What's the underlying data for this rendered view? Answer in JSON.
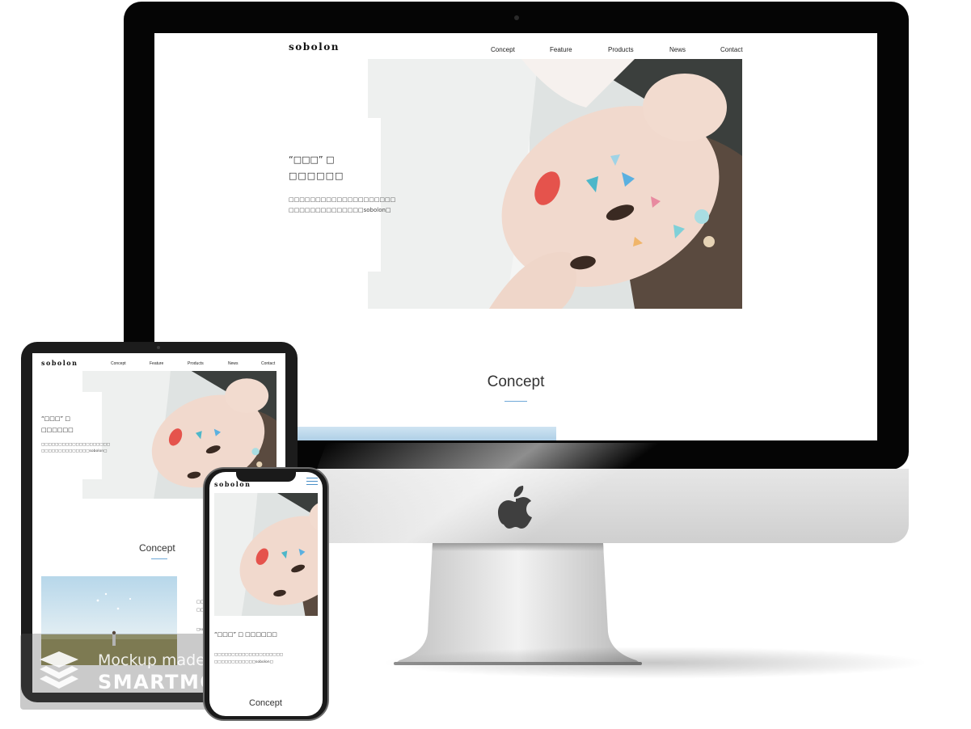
{
  "site": {
    "logo": "sobolon",
    "nav": [
      "Concept",
      "Feature",
      "Products",
      "News",
      "Contact"
    ],
    "tagline_line1": "“□□□” □",
    "tagline_line2": "□□□□□□",
    "desc_line1": "□□□□□□□□□□□□□□□□□□□□",
    "desc_line2": "□□□□□□□□□□□□□□sobolon□",
    "section_title": "Concept",
    "mobile_tagline": "“□□□” □ □□□□□□",
    "mobile_desc_line1": "□□□□□□□□□□□□□□□□□□□□",
    "mobile_desc_line2": "□□□□□□□□□□□□sobolon□",
    "tablet_side_line1": "□□",
    "tablet_side_line2": "□□",
    "tablet_side_line3": "□so"
  },
  "watermark": {
    "line1": "Mockup made with",
    "line2": "SMARTMOCKUPS"
  },
  "colors": {
    "accent_line": "#6fa9d8",
    "menu_icon": "#4a90c8",
    "device_black": "#050505",
    "imac_silver": "#d9d9d9"
  },
  "icons": [
    "apple-logo-icon",
    "hamburger-menu-icon",
    "smartmockups-logo-icon"
  ]
}
